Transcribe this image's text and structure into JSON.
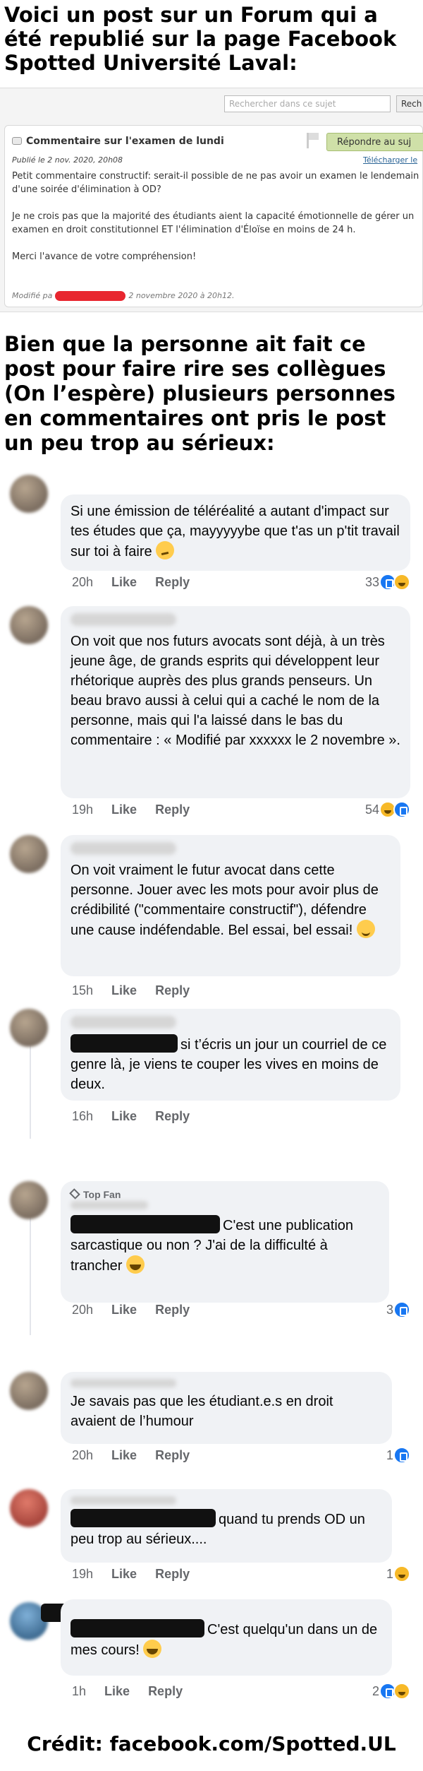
{
  "intro_text": "Voici un post sur un Forum qui a été republié sur la page Facebook Spotted Université Laval:",
  "forum": {
    "search_placeholder": "Rechercher dans ce sujet",
    "search_button": "Rech",
    "post_title": "Commentaire sur l'examen de lundi",
    "reply_button": "Répondre au suj",
    "published": "Publié le 2 nov. 2020, 20h08",
    "download": "Télécharger le",
    "body": [
      "Petit commentaire constructif: serait-il possible de ne pas avoir un examen le lendemain d'une soirée d'élimination à OD?",
      "Je ne crois pas que la majorité des étudiants aient la capacité émotionnelle de gérer un examen en droit constitutionnel ET l'élimination d'Éloïse en moins de 24 h.",
      "Merci l'avance de votre compréhension!"
    ],
    "modified_prefix": "Modifié pa",
    "modified_suffix": "2 novembre 2020 à 20h12."
  },
  "middle_text": "Bien que la personne ait fait ce post pour faire rire ses collègues (On l’espère) plusieurs personnes en commentaires ont pris le post un peu trop au sérieux:",
  "actions": {
    "like": "Like",
    "reply": "Reply"
  },
  "comments": [
    {
      "text": "Si une émission de téléréalité a autant d'impact sur tes études que ça, mayyyyybe que t'as un p'tit travail sur toi à faire",
      "emoji": "confused-face",
      "time": "20h",
      "count": "33"
    },
    {
      "text": "On voit que nos futurs avocats sont déjà, à un très jeune âge, de grands esprits qui développent leur rhétorique auprès des plus grands penseurs. Un beau bravo aussi à celui qui a caché le nom de la personne, mais qui l'a laissé dans le bas du commentaire : « Modifié par xxxxxx le 2 novembre ».",
      "time": "19h",
      "count": "54"
    },
    {
      "text": "On voit vraiment le futur avocat dans cette personne. Jouer avec les mots pour avoir plus de crédibilité (\"commentaire constructif\"), défendre une cause indéfendable. Bel essai, bel essai!",
      "emoji": "sweat-smile",
      "time": "15h"
    },
    {
      "text": "si t’écris un jour un courriel de ce genre là, je viens te couper les vives en moins de deux.",
      "time": "16h"
    },
    {
      "badge": "Top Fan",
      "text": "C'est une publication sarcastique ou non ? J'ai de la difficulté à trancher",
      "emoji": "laughing-face",
      "time": "20h",
      "count": "3"
    },
    {
      "text": "Je savais pas que les étudiant.e.s en droit avaient de l’humour",
      "time": "20h",
      "count": "1"
    },
    {
      "text": "quand tu prends OD un peu trop au sérieux....",
      "time": "19h",
      "count": "1"
    },
    {
      "text": "C'est quelqu'un dans un de mes cours!",
      "emoji": "laughing-face",
      "time": "1h",
      "count": "2"
    }
  ],
  "credit": "Crédit: facebook.com/Spotted.UL",
  "colors": {
    "like_blue": "#1877f2",
    "bubble_bg": "#f0f2f5",
    "redaction_red": "#e8262f",
    "forum_button": "#cfe0a8"
  }
}
